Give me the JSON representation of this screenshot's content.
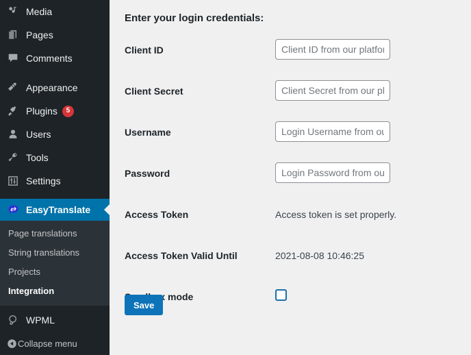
{
  "sidebar": {
    "items": [
      {
        "label": "Media",
        "icon": "media-icon",
        "badge": null,
        "current": false
      },
      {
        "label": "Pages",
        "icon": "pages-icon",
        "badge": null,
        "current": false
      },
      {
        "label": "Comments",
        "icon": "comments-icon",
        "badge": null,
        "current": false
      },
      {
        "label": "Appearance",
        "icon": "appearance-brush-icon",
        "badge": null,
        "current": false
      },
      {
        "label": "Plugins",
        "icon": "plugins-plug-icon",
        "badge": "5",
        "current": false
      },
      {
        "label": "Users",
        "icon": "users-icon",
        "badge": null,
        "current": false
      },
      {
        "label": "Tools",
        "icon": "tools-wrench-icon",
        "badge": null,
        "current": false
      },
      {
        "label": "Settings",
        "icon": "settings-sliders-icon",
        "badge": null,
        "current": false
      },
      {
        "label": "EasyTranslate",
        "icon": "easytranslate-bubble-icon",
        "badge": null,
        "current": true
      }
    ],
    "submenu": [
      {
        "label": "Page translations",
        "current": false
      },
      {
        "label": "String translations",
        "current": false
      },
      {
        "label": "Projects",
        "current": false
      },
      {
        "label": "Integration",
        "current": true
      }
    ],
    "bottom_items": [
      {
        "label": "WPML",
        "icon": "wpml-icon"
      }
    ],
    "collapse": {
      "label": "Collapse menu",
      "icon": "collapse-arrow-icon"
    },
    "colors": {
      "background": "#1d2327",
      "submenu_background": "#2c3338",
      "current_highlight": "#0073aa",
      "badge": "#d63638"
    }
  },
  "main": {
    "title": "Enter your login credentials:",
    "fields": [
      {
        "label": "Client ID",
        "type": "text",
        "value": "",
        "placeholder": "Client ID from our platform"
      },
      {
        "label": "Client Secret",
        "type": "text",
        "value": "",
        "placeholder": "Client Secret from our platform"
      },
      {
        "label": "Username",
        "type": "text",
        "value": "",
        "placeholder": "Login Username from our platform"
      },
      {
        "label": "Password",
        "type": "text",
        "value": "",
        "placeholder": "Login Password from our platform"
      },
      {
        "label": "Access Token",
        "type": "static",
        "value": "Access token is set properly."
      },
      {
        "label": "Access Token Valid Until",
        "type": "static",
        "value": "2021-08-08 10:46:25"
      },
      {
        "label": "Sandbox mode",
        "type": "checkbox",
        "checked": false
      }
    ],
    "save_label": "Save",
    "colors": {
      "background": "#f0f0f1",
      "button": "#0e73b9",
      "checkbox_border": "#1d6fa5"
    }
  }
}
